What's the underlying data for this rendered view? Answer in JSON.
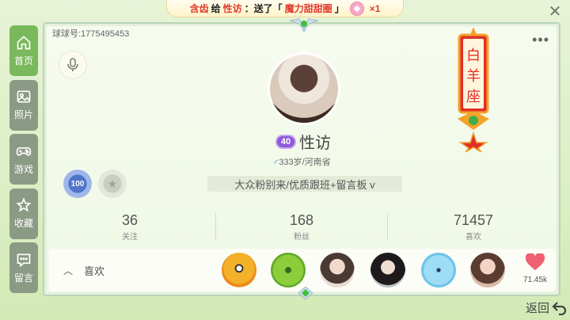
{
  "banner": {
    "prefix": "含齿",
    "gives": "给",
    "target": "性访",
    "sent": "：送了「",
    "gift": "魔力甜甜圈",
    "close_quote": "」",
    "count": "×1"
  },
  "sidebar": {
    "items": [
      {
        "label": "首页",
        "icon": "home-icon"
      },
      {
        "label": "照片",
        "icon": "photo-icon"
      },
      {
        "label": "游戏",
        "icon": "gamepad-icon"
      },
      {
        "label": "收藏",
        "icon": "star-icon"
      },
      {
        "label": "留言",
        "icon": "message-icon"
      }
    ]
  },
  "profile": {
    "uid_label": "球球号:1775495453",
    "level": "40",
    "name": "性访",
    "gender_symbol": "♂",
    "info": "333岁/河南省",
    "badge_value": "100",
    "group_tag": "大众粉别来/优质跟班+留言板 v",
    "zodiac": [
      "白",
      "羊",
      "座"
    ]
  },
  "stats": [
    {
      "value": "36",
      "label": "关注"
    },
    {
      "value": "168",
      "label": "粉丝"
    },
    {
      "value": "71457",
      "label": "喜欢"
    }
  ],
  "likes": {
    "title": "喜欢",
    "heart_count": "71.45k"
  },
  "nav": {
    "back_label": "返回"
  },
  "colors": {
    "accent": "#79b85c",
    "sidebar_bg": "#8b9a85",
    "heart": "#f06070",
    "zodiac_red": "#e0302a",
    "level_purple": "#8e5bd8"
  }
}
